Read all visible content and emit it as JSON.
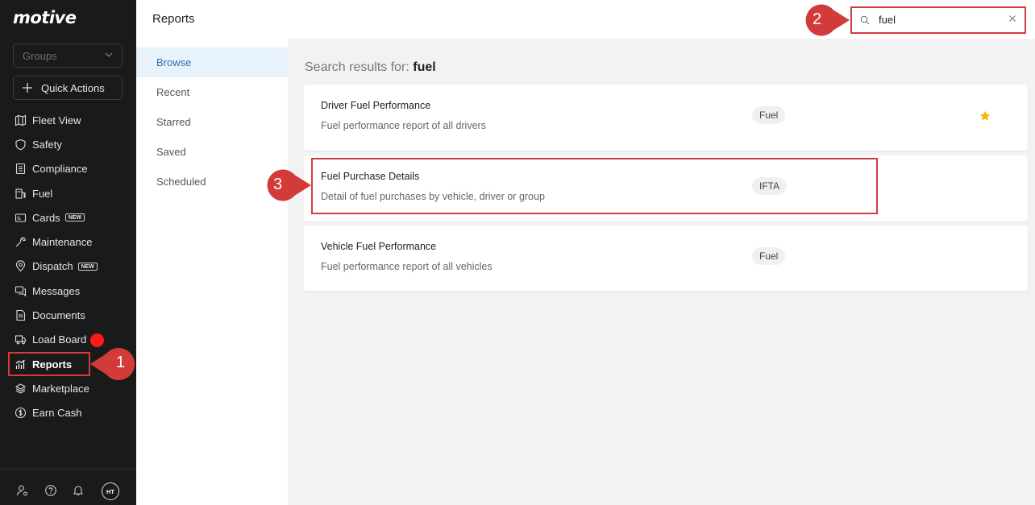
{
  "sidebar": {
    "logo": "motive",
    "groups_placeholder": "Groups",
    "quick_actions": "Quick Actions",
    "items": [
      {
        "label": "Fleet View",
        "icon": "map-icon"
      },
      {
        "label": "Safety",
        "icon": "shield-icon"
      },
      {
        "label": "Compliance",
        "icon": "clipboard-icon"
      },
      {
        "label": "Fuel",
        "icon": "fuel-pump-icon"
      },
      {
        "label": "Cards",
        "icon": "card-icon",
        "badge": "NEW"
      },
      {
        "label": "Maintenance",
        "icon": "wrench-icon"
      },
      {
        "label": "Dispatch",
        "icon": "location-pin-icon",
        "badge": "NEW"
      },
      {
        "label": "Messages",
        "icon": "chat-icon"
      },
      {
        "label": "Documents",
        "icon": "document-icon"
      },
      {
        "label": "Load Board",
        "icon": "truck-icon"
      },
      {
        "label": "Reports",
        "icon": "bar-chart-icon",
        "active": true
      },
      {
        "label": "Marketplace",
        "icon": "layers-icon"
      },
      {
        "label": "Earn Cash",
        "icon": "dollar-icon"
      }
    ],
    "avatar_initials": "HT"
  },
  "header": {
    "title": "Reports",
    "search_value": "fuel"
  },
  "subnav": {
    "items": [
      "Browse",
      "Recent",
      "Starred",
      "Saved",
      "Scheduled"
    ],
    "active": "Browse"
  },
  "main": {
    "results_prefix": "Search results for:",
    "results_query": "fuel",
    "results": [
      {
        "name": "Driver Fuel Performance",
        "description": "Fuel performance report of all drivers",
        "tag": "Fuel",
        "starred": true
      },
      {
        "name": "Fuel Purchase Details",
        "description": "Detail of fuel purchases by vehicle, driver or group",
        "tag": "IFTA",
        "starred": false
      },
      {
        "name": "Vehicle Fuel Performance",
        "description": "Fuel performance report of all vehicles",
        "tag": "Fuel",
        "starred": false
      }
    ]
  },
  "callouts": [
    "1",
    "2",
    "3"
  ],
  "colors": {
    "sidebar_bg": "#1a1a1a",
    "annotation_red": "#d33b3b",
    "star": "#f5b800",
    "active_subnav_bg": "#e8f2fb",
    "load_board_dot": "#ff1a1a"
  }
}
